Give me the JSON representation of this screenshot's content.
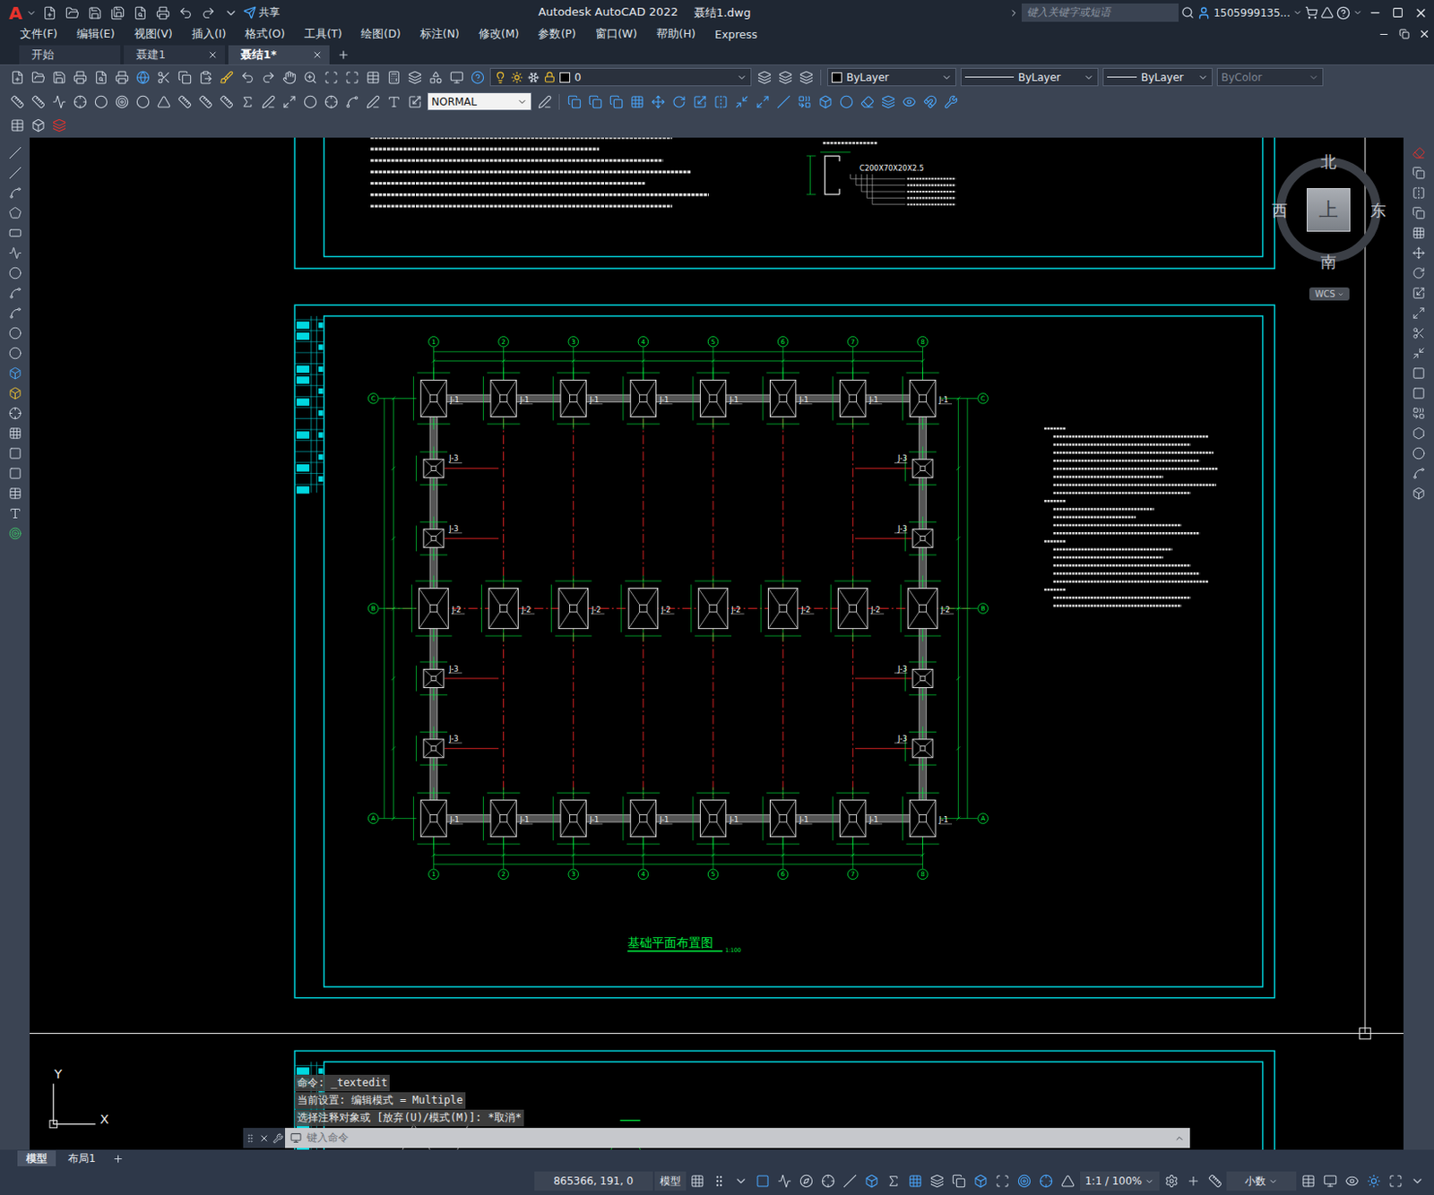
{
  "app": {
    "logo": "A",
    "title": "Autodesk AutoCAD 2022",
    "file": "聂结1.dwg",
    "share": "共享",
    "search_placeholder": "键入关键字或短语",
    "user": "1505999135..."
  },
  "menu": [
    "文件(F)",
    "编辑(E)",
    "视图(V)",
    "插入(I)",
    "格式(O)",
    "工具(T)",
    "绘图(D)",
    "标注(N)",
    "修改(M)",
    "参数(P)",
    "窗口(W)",
    "帮助(H)",
    "Express"
  ],
  "doc_tabs": [
    {
      "label": "开始",
      "selected": false,
      "closable": false
    },
    {
      "label": "聂建1",
      "selected": false,
      "closable": true
    },
    {
      "label": "聂结1*",
      "selected": true,
      "closable": true
    }
  ],
  "properties": {
    "layer": "0",
    "color": "ByLayer",
    "linetype": "ByLayer",
    "lineweight": "ByLayer",
    "plotstyle": "ByColor",
    "plotstyle_disabled": true,
    "dimstyle": "NORMAL"
  },
  "viewcube": {
    "north": "北",
    "south": "南",
    "east": "东",
    "west": "西",
    "face": "上",
    "ucs": "WCS"
  },
  "ucs_icon": {
    "x": "X",
    "y": "Y"
  },
  "drawing": {
    "title": "基础平面布置图",
    "scale": "1:100",
    "section_label": "C200X70X20X2.5",
    "columns": [
      "1",
      "2",
      "3",
      "4",
      "5",
      "6",
      "7",
      "8"
    ],
    "rows": [
      {
        "label": "C",
        "kind": "edge",
        "footings": [
          "J-1",
          "J-1",
          "J-1",
          "J-1",
          "J-1",
          "J-1",
          "J-1",
          "J-1"
        ]
      },
      {
        "label": "",
        "kind": "side",
        "footings": [
          "J-3",
          "",
          "",
          "",
          "",
          "",
          "",
          "J-3"
        ]
      },
      {
        "label": "",
        "kind": "side",
        "footings": [
          "J-3",
          "",
          "",
          "",
          "",
          "",
          "",
          "J-3"
        ]
      },
      {
        "label": "B",
        "kind": "center",
        "footings": [
          "J-2",
          "J-2",
          "J-2",
          "J-2",
          "J-2",
          "J-2",
          "J-2",
          "J-2"
        ]
      },
      {
        "label": "",
        "kind": "side",
        "footings": [
          "J-3",
          "",
          "",
          "",
          "",
          "",
          "",
          "J-3"
        ]
      },
      {
        "label": "",
        "kind": "side",
        "footings": [
          "J-3",
          "",
          "",
          "",
          "",
          "",
          "",
          "J-3"
        ]
      },
      {
        "label": "A",
        "kind": "edge",
        "footings": [
          "J-1",
          "J-1",
          "J-1",
          "J-1",
          "J-1",
          "J-1",
          "J-1",
          "J-1"
        ]
      }
    ]
  },
  "command": {
    "history": [
      "命令: _textedit",
      "当前设置: 编辑模式 = Multiple",
      "选择注释对象或 [放弃(U)/模式(M)]: *取消*"
    ],
    "placeholder": "键入命令"
  },
  "layout_tabs": [
    {
      "label": "模型",
      "selected": true
    },
    {
      "label": "布局1",
      "selected": false
    }
  ],
  "status": {
    "coords": "865366, 191, 0",
    "space": "模型",
    "scale": "1:1 / 100%",
    "units": "小数"
  }
}
